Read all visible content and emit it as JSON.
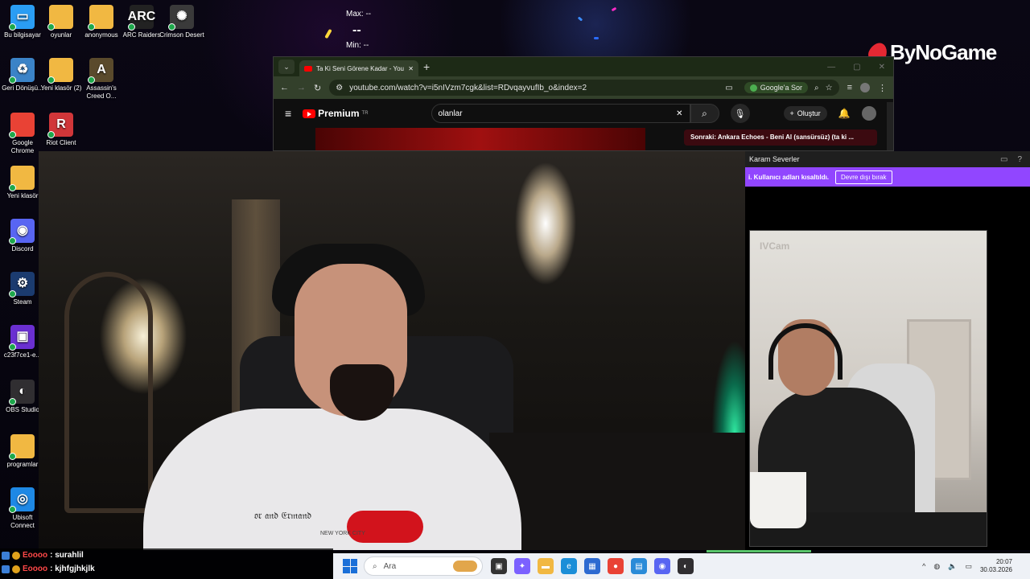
{
  "desktop": {
    "icons": [
      {
        "label": "Bu bilgisayar",
        "glyph": "▭",
        "color": "#2a9df4"
      },
      {
        "label": "oyunlar",
        "glyph": "",
        "color": "#f1b842"
      },
      {
        "label": "anonymous",
        "glyph": "",
        "color": "#f1b842"
      },
      {
        "label": "ARC Raiders",
        "glyph": "ARC",
        "color": "#222222"
      },
      {
        "label": "Crimson Desert",
        "glyph": "✺",
        "color": "#3a3a3a"
      },
      {
        "label": "Geri Dönüşü...",
        "glyph": "♻",
        "color": "#3b83c7"
      },
      {
        "label": "Yeni klasör (2)",
        "glyph": "",
        "color": "#f1b842"
      },
      {
        "label": "Assassin's Creed O...",
        "glyph": "A",
        "color": "#5a4a2c"
      },
      {
        "label": "Google Chrome",
        "glyph": "",
        "color": "#e94235"
      },
      {
        "label": "Riot Client",
        "glyph": "R",
        "color": "#d13639"
      },
      {
        "label": "Yeni klasör",
        "glyph": "",
        "color": "#f1b842"
      },
      {
        "label": "Discord",
        "glyph": "◉",
        "color": "#5865f2"
      },
      {
        "label": "Steam",
        "glyph": "⚙",
        "color": "#1b3b6f"
      },
      {
        "label": "c23f7ce1-e...",
        "glyph": "▣",
        "color": "#6a2fd1"
      },
      {
        "label": "OBS Studio",
        "glyph": "◐",
        "color": "#302e31"
      },
      {
        "label": "programlar",
        "glyph": "",
        "color": "#f1b842"
      },
      {
        "label": "Ubisoft Connect",
        "glyph": "◎",
        "color": "#1e88e5"
      }
    ]
  },
  "overlay": {
    "max_label": "Max: --",
    "value": "--",
    "min_label": "Min: --",
    "brand": "ByNoGame"
  },
  "browser": {
    "tab_title": "Ta Ki Seni Görene Kadar - YouTube",
    "url": "youtube.com/watch?v=i5nIVzm7cgk&list=RDvqayvufIb_o&index=2",
    "ask_google": "Google'a Sor",
    "youtube": {
      "premium_label": "Premium",
      "region": "TR",
      "search_value": "olanlar",
      "create_label": "Oluştur",
      "next_card": "Sonraki: Ankara Echoes - Beni Al (sansürsüz) (ta ki ..."
    }
  },
  "side_panel": {
    "title": "Karam Severler",
    "notice": "i. Kullanıcı adları kısaltıldı.",
    "disable_button": "Devre dışı bırak",
    "cam_watermark": "IVCam"
  },
  "main_cam": {
    "shirt_text": "𝔬𝔯 𝔞𝔫𝔡 𝔈𝔯𝔪𝔞𝔫𝔡",
    "shirt_sub": "NEW YORK CITY"
  },
  "stream_chat": [
    {
      "user": "Eoooo",
      "message": ": surahlil"
    },
    {
      "user": "Eoooo",
      "message": ": kjhfgjhkjlk"
    }
  ],
  "taskbar": {
    "search_placeholder": "Ara",
    "apps": [
      {
        "name": "task-view",
        "color": "#333333",
        "glyph": "▣"
      },
      {
        "name": "copilot",
        "color": "#7b61ff",
        "glyph": "✦"
      },
      {
        "name": "file-explorer",
        "color": "#f1b842",
        "glyph": "▬"
      },
      {
        "name": "edge",
        "color": "#1b8ed8",
        "glyph": "e"
      },
      {
        "name": "store",
        "color": "#2d6ad1",
        "glyph": "▦"
      },
      {
        "name": "chrome",
        "color": "#e94235",
        "glyph": "●"
      },
      {
        "name": "photos",
        "color": "#2a8bd8",
        "glyph": "▤"
      },
      {
        "name": "discord",
        "color": "#5865f2",
        "glyph": "◉"
      },
      {
        "name": "obs",
        "color": "#302e31",
        "glyph": "◐"
      }
    ],
    "time": "20:07",
    "date": "30.03.2026"
  }
}
